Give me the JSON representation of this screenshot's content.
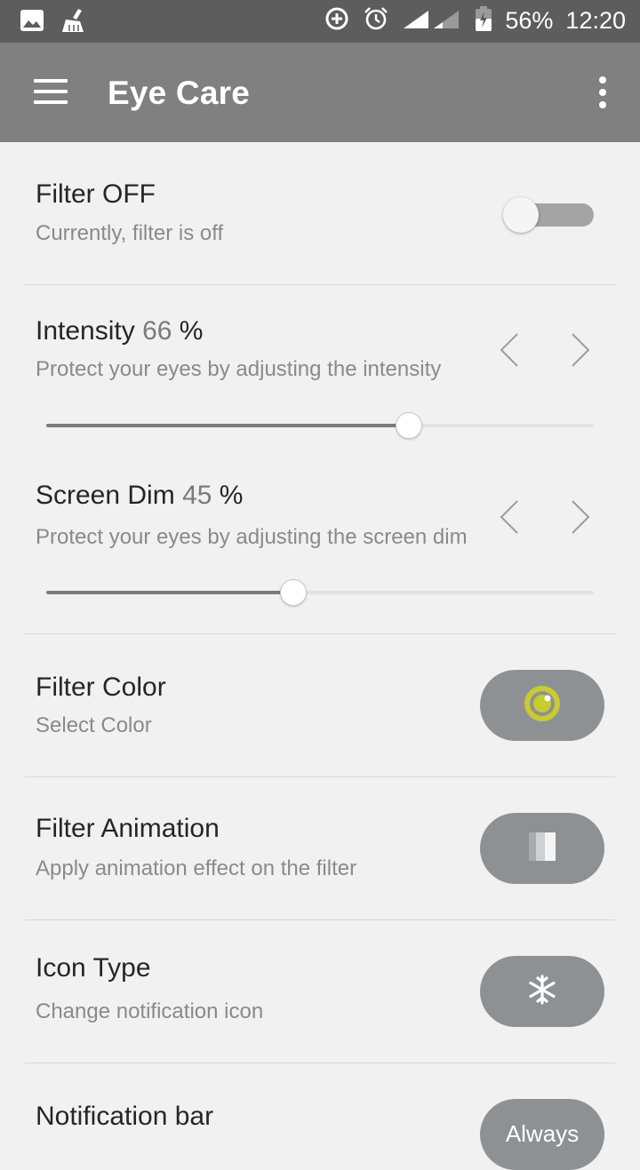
{
  "status_bar": {
    "battery": "56%",
    "time": "12:20"
  },
  "app_bar": {
    "title": "Eye Care"
  },
  "filter": {
    "title": "Filter OFF",
    "subtitle": "Currently, filter is off",
    "enabled": false
  },
  "intensity": {
    "label": "Intensity",
    "value": "66",
    "unit": "%",
    "subtitle": "Protect your eyes by adjusting the intensity",
    "level": 0.66
  },
  "screen_dim": {
    "label": "Screen Dim",
    "value": "45",
    "unit": "%",
    "subtitle": "Protect your eyes by adjusting the screen dim",
    "level": 0.45
  },
  "filter_color": {
    "title": "Filter Color",
    "subtitle": "Select Color",
    "color": "#c8cc2e"
  },
  "filter_animation": {
    "title": "Filter Animation",
    "subtitle": "Apply animation effect on the filter"
  },
  "icon_type": {
    "title": "Icon Type",
    "subtitle": "Change notification icon",
    "icon": "snowflake-icon"
  },
  "notification_bar": {
    "title": "Notification bar",
    "button_label": "Always"
  },
  "colors": {
    "status_bar": "#5d5d5d",
    "app_bar": "#808080",
    "pill": "#8e9194"
  }
}
